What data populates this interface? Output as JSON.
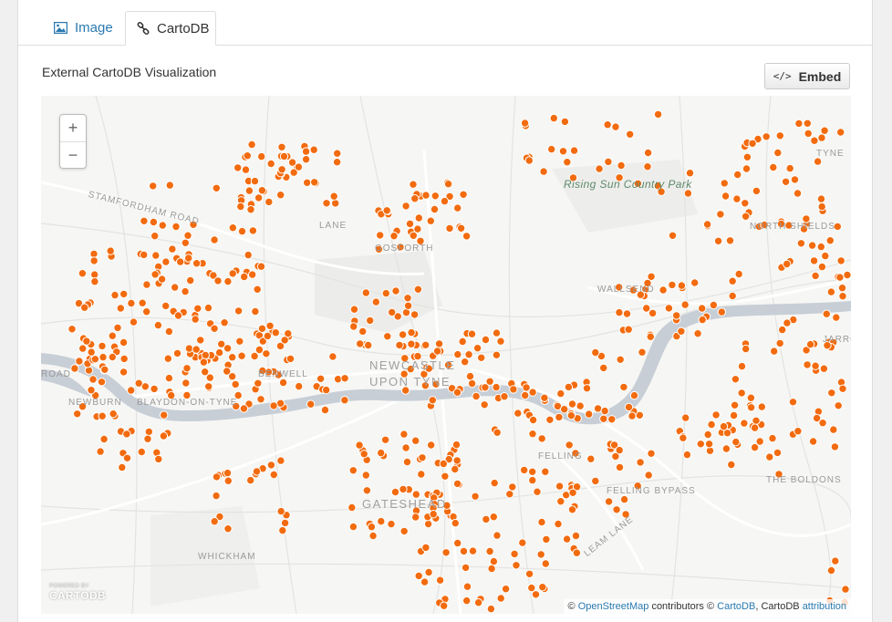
{
  "tabs": [
    {
      "label": "Image",
      "icon": "image-icon",
      "active": false
    },
    {
      "label": "CartoDB",
      "icon": "link-icon",
      "active": true
    }
  ],
  "section_title": "External CartoDB Visualization",
  "embed_button": {
    "label": "Embed",
    "icon_glyph": "</>"
  },
  "map": {
    "zoom_in": "+",
    "zoom_out": "−",
    "logo_small": "POWERED BY",
    "logo": "CARTODB",
    "marker_color": "#f26b0f",
    "water_color": "#c7ced6",
    "labels": {
      "stamfordham": "STAMFORDHAM ROAD",
      "rising_sun": "Rising Sun Country Park",
      "gosforth": "GOSFORTH",
      "northshields": "NORTH SHIELDS",
      "tyne": "TYNE",
      "walkergate": "WALLSEND",
      "newcastle1": "NEWCASTLE",
      "newcastle2": "UPON TYNE",
      "jarrow": "JARROW",
      "newburn": "NEWBURN",
      "blaydon": "BLAYDON-ON-TYNE",
      "road": "ROAD",
      "felling": "FELLING",
      "felling_bypass": "FELLING BYPASS",
      "gateshead": "GATESHEAD",
      "boldons": "THE BOLDONS",
      "leam": "LEAM LANE",
      "whickham": "WHICKHAM",
      "benwell": "BENWELL",
      "lane": "LANE"
    },
    "attribution": {
      "prefix": "©",
      "osm": "OpenStreetMap",
      "contributors": "contributors ©",
      "cartodb": "CartoDB",
      "cartodb_attr": ", CartoDB",
      "attribution": "attribution"
    }
  }
}
